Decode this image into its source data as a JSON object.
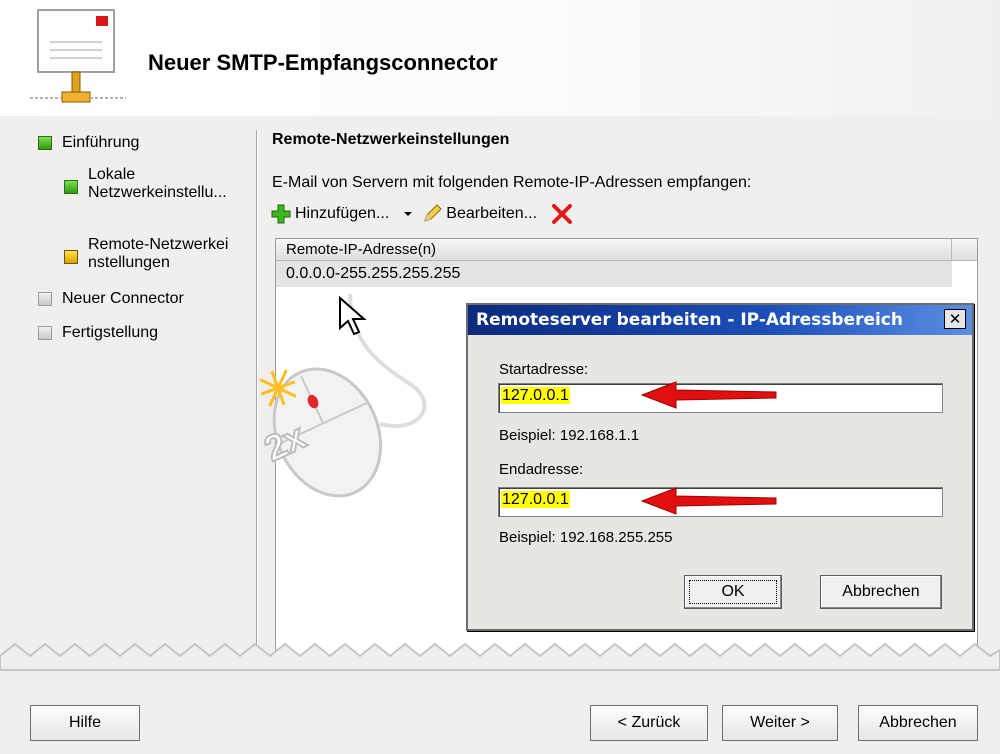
{
  "wizard": {
    "title": "Neuer SMTP-Empfangsconnector"
  },
  "nav": {
    "items": [
      {
        "label": "Einführung",
        "state": "done"
      },
      {
        "label": "Lokale Netzwerkeinstellu...",
        "state": "done"
      },
      {
        "label": "Remote-Netzwerkei nstellungen",
        "state": "current"
      },
      {
        "label": "Neuer Connector",
        "state": "pending"
      },
      {
        "label": "Fertigstellung",
        "state": "pending"
      }
    ]
  },
  "main": {
    "section_title": "Remote-Netzwerkeinstellungen",
    "description": "E-Mail von Servern mit folgenden Remote-IP-Adressen empfangen:",
    "toolbar": {
      "add_label": "Hinzufügen...",
      "edit_label": "Bearbeiten..."
    },
    "grid": {
      "column_header": "Remote-IP-Adresse(n)",
      "rows": [
        "0.0.0.0-255.255.255.255"
      ]
    }
  },
  "overlay": {
    "mouse_label": "2x"
  },
  "dialog": {
    "title": "Remoteserver bearbeiten - IP-Adressbereich",
    "start_label": "Startadresse:",
    "start_value": "127.0.0.1",
    "start_example": "Beispiel: 192.168.1.1",
    "end_label": "Endadresse:",
    "end_value": "127.0.0.1",
    "end_example": "Beispiel: 192.168.255.255",
    "ok_label": "OK",
    "cancel_label": "Abbrechen"
  },
  "footer": {
    "help_label": "Hilfe",
    "back_label": "< Zurück",
    "next_label": "Weiter >",
    "cancel_label": "Abbrechen"
  },
  "colors": {
    "highlight": "#ffff00",
    "arrow": "#e01010",
    "titlebar": "#0b2a7c"
  }
}
